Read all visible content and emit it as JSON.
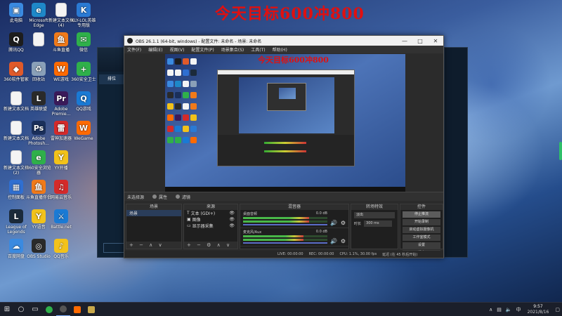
{
  "desktop": {
    "headline": "今天目标600冲800",
    "icons": [
      {
        "label": "此电脑",
        "color": "#3a8ae0",
        "glyph": "▣"
      },
      {
        "label": "腾讯QQ",
        "color": "#1d1d1d",
        "glyph": "Q"
      },
      {
        "label": "360软件管家",
        "color": "#e05a2a",
        "glyph": "◆"
      },
      {
        "label": "新建文本文档",
        "color": "#f4f4f4",
        "glyph": ""
      },
      {
        "label": "新建文本文档",
        "color": "#f4f4f4",
        "glyph": ""
      },
      {
        "label": "新建文本文档 (2)",
        "color": "#f4f4f4",
        "glyph": ""
      },
      {
        "label": "控制面板",
        "color": "#2f6fd1",
        "glyph": "▦"
      },
      {
        "label": "League of Legends",
        "color": "#1b2a3a",
        "glyph": "L"
      },
      {
        "label": "百度网盘",
        "color": "#3a8ae0",
        "glyph": "☁"
      },
      {
        "label": "Microsoft Edge",
        "color": "#1e88c8",
        "glyph": "e"
      },
      {
        "label": "",
        "color": "#f4f4f4",
        "glyph": ""
      },
      {
        "label": "回收站",
        "color": "#8aa0b8",
        "glyph": "♻"
      },
      {
        "label": "英雄联盟",
        "color": "#2a2a2a",
        "glyph": "L"
      },
      {
        "label": "Adobe Photosh...",
        "color": "#1a2f5a",
        "glyph": "Ps"
      },
      {
        "label": "360安全浏览器",
        "color": "#2fb04a",
        "glyph": "e"
      },
      {
        "label": "斗鱼直播伴侣",
        "color": "#f07a1a",
        "glyph": "鱼"
      },
      {
        "label": "YY语音",
        "color": "#f2c21a",
        "glyph": "Y"
      },
      {
        "label": "OBS Studio",
        "color": "#2a2a2a",
        "glyph": "◎"
      },
      {
        "label": "新建文本文档 (4)",
        "color": "#f4f4f4",
        "glyph": ""
      },
      {
        "label": "斗鱼直播",
        "color": "#f07a1a",
        "glyph": "鱼"
      },
      {
        "label": "WE游戏",
        "color": "#ff6a00",
        "glyph": "W"
      },
      {
        "label": "Adobe Premie...",
        "color": "#3a1a5a",
        "glyph": "Pr"
      },
      {
        "label": "雷神加速器",
        "color": "#d42a2a",
        "glyph": "雷"
      },
      {
        "label": "YY开播",
        "color": "#f2c21a",
        "glyph": "Y"
      },
      {
        "label": "网易云音乐",
        "color": "#d42a2a",
        "glyph": "♫"
      },
      {
        "label": "Battle.net",
        "color": "#1a7ad4",
        "glyph": "⚔"
      },
      {
        "label": "QQ音乐",
        "color": "#f2c21a",
        "glyph": "♪"
      },
      {
        "label": "KLY-LOL英雄专用版",
        "color": "#2a7ad4",
        "glyph": "K"
      },
      {
        "label": "微信",
        "color": "#2fb04a",
        "glyph": "✉"
      },
      {
        "label": "360安全卫士",
        "color": "#2fb04a",
        "glyph": "+"
      },
      {
        "label": "QQ游戏",
        "color": "#1a7ad4",
        "glyph": "Q"
      },
      {
        "label": "WeGame",
        "color": "#ff6a00",
        "glyph": "W"
      }
    ]
  },
  "obs": {
    "title": "OBS 26.1.1 (64-bit, windows) - 配置文件: 未命名 - 场景: 未命名",
    "menu": [
      "文件(F)",
      "编辑(E)",
      "视图(V)",
      "配置文件(P)",
      "场景集合(S)",
      "工具(T)",
      "帮助(H)"
    ],
    "preview_headline": "今天目标600冲800",
    "scene_bar_label": "未选择源",
    "scene_bar_props": "属性",
    "scene_bar_filters": "滤镜",
    "scenes_title": "场景",
    "scenes": [
      "场景"
    ],
    "sources_title": "来源",
    "sources": [
      "文本 (GDI+)",
      "图像",
      "显示器采集"
    ],
    "mixer_title": "混音器",
    "mixer": [
      {
        "name": "桌面音频",
        "db": "0.0 dB",
        "level": 0.78
      },
      {
        "name": "麦克风/Aux",
        "db": "0.0 dB",
        "level": 0.72
      }
    ],
    "transitions_title": "转场特效",
    "transition_value": "淡出",
    "duration_label": "时长",
    "duration_value": "300 ms",
    "controls_title": "控件",
    "controls": [
      "停止推流",
      "开始录制",
      "启动虚拟摄像机",
      "工作室模式",
      "设置",
      "退出"
    ],
    "status": {
      "live": "LIVE: 00:00:00",
      "rec": "REC: 00:00:00",
      "cpu": "CPU: 1.1%, 30.00 fps",
      "extra": "延迟 (在 45 秒后开始)"
    }
  },
  "taskbar": {
    "start_icon": "windows-icon",
    "time": "9:57",
    "date": "2021/8/16",
    "lang": "中",
    "apps": [
      {
        "name": "search",
        "color": "#ffffff"
      },
      {
        "name": "task-view",
        "color": "#ffffff"
      },
      {
        "name": "360browser",
        "color": "#2fb04a"
      },
      {
        "name": "obs",
        "color": "#444444"
      },
      {
        "name": "wegame",
        "color": "#ff6a00"
      },
      {
        "name": "league",
        "color": "#c8a84a"
      }
    ]
  },
  "colors": {
    "headline": "#e01010",
    "obs_bg": "#2b2b2b",
    "meter_green": "#48b848",
    "taskbar": "#1b1f2a"
  }
}
